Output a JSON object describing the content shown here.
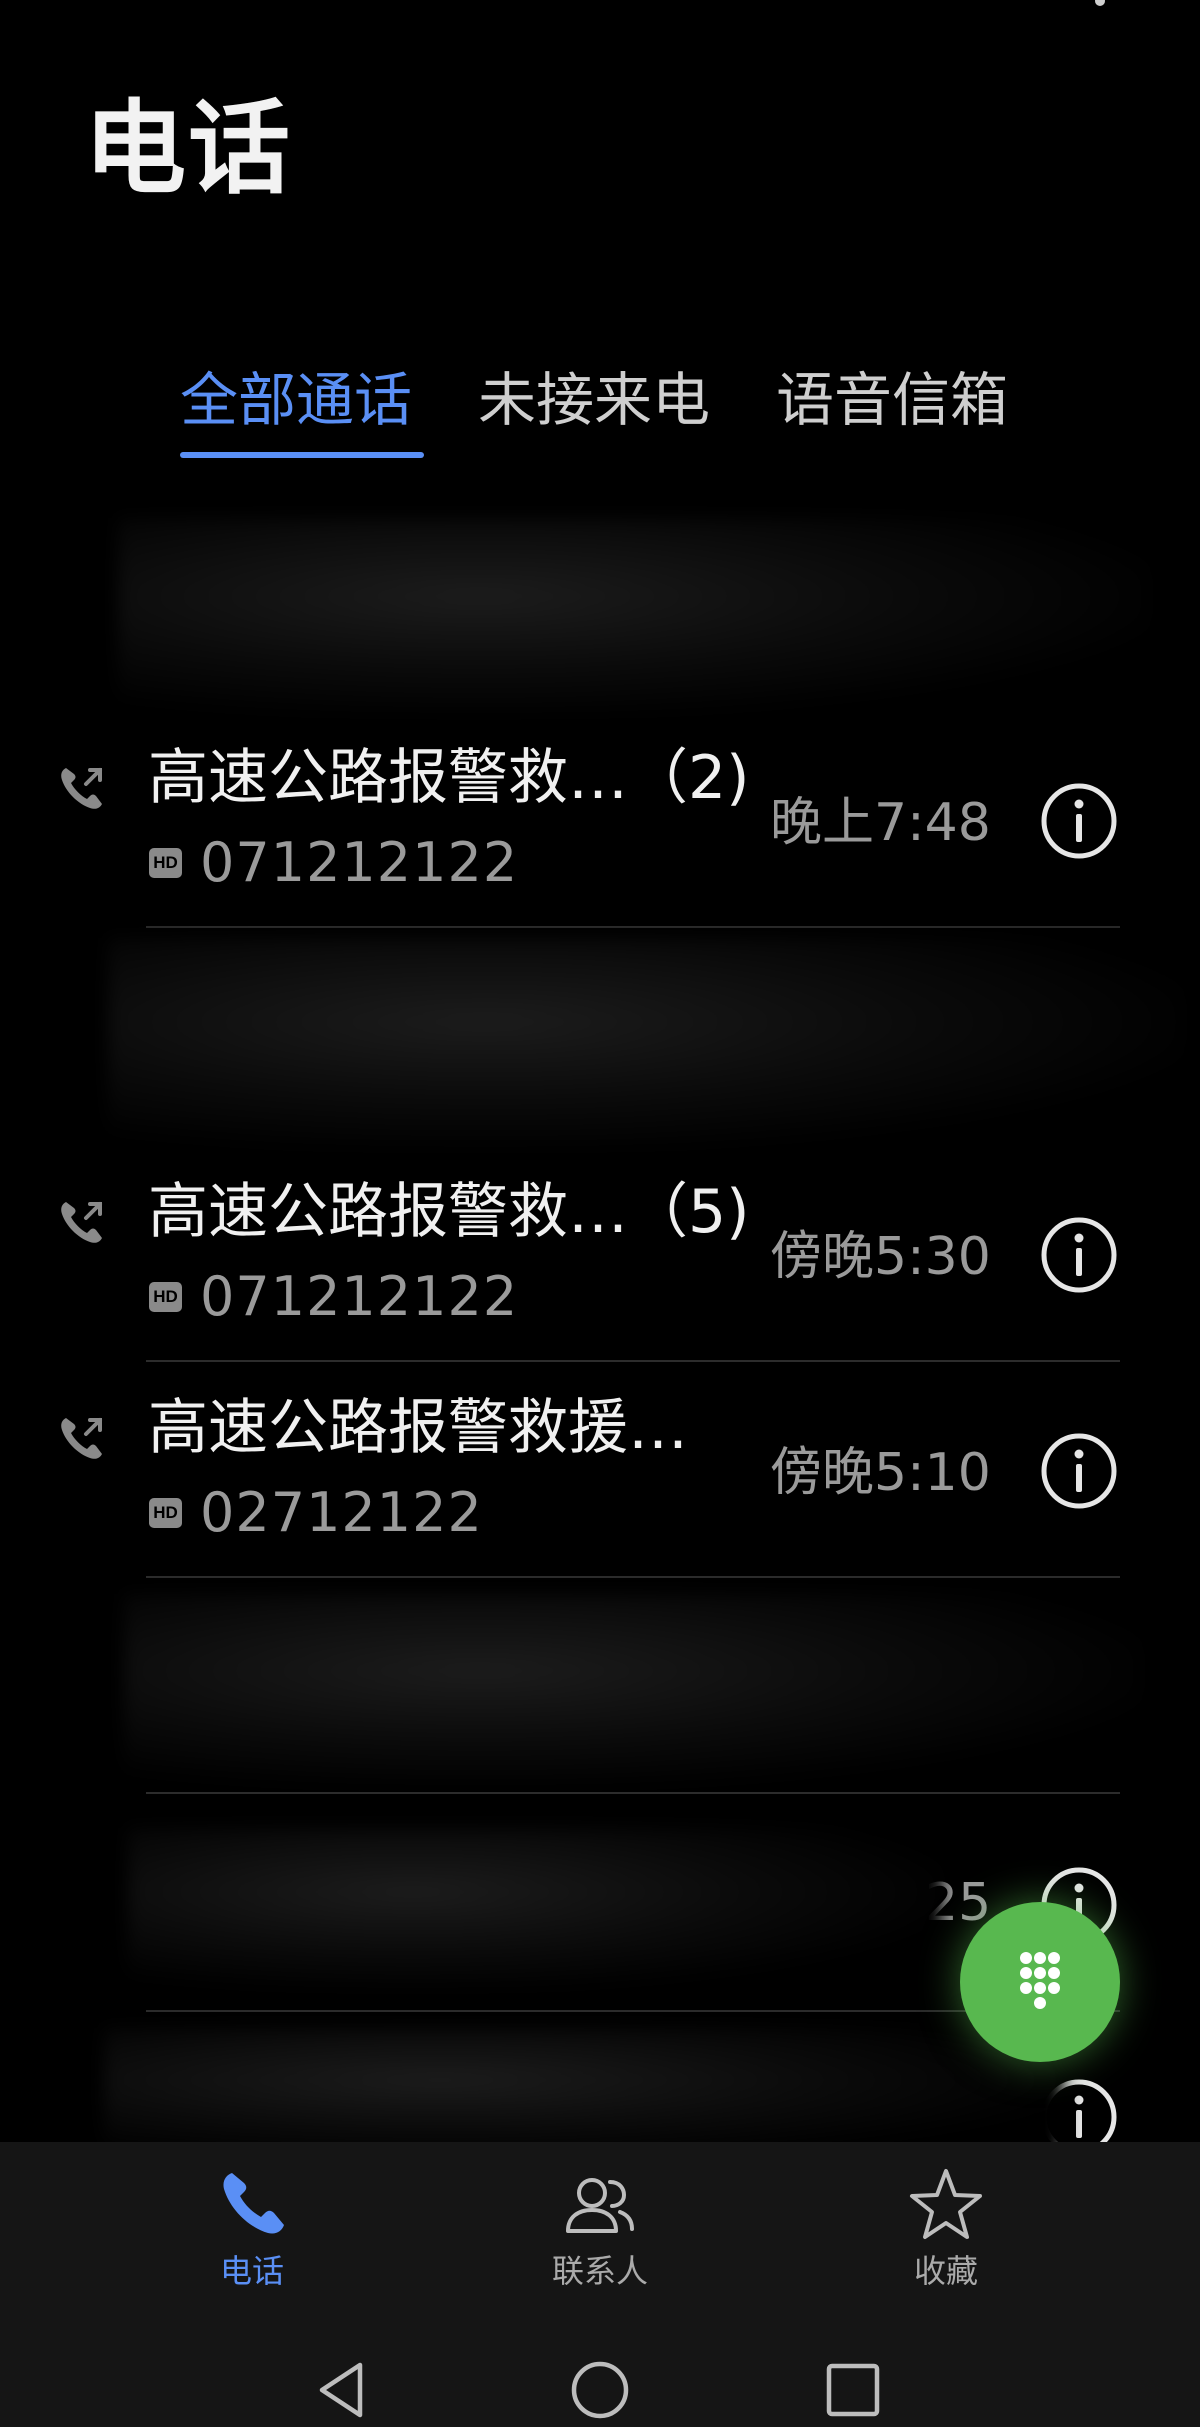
{
  "header": {
    "title": "电话"
  },
  "tabs": [
    {
      "label": "全部通话",
      "active": true
    },
    {
      "label": "未接来电",
      "active": false
    },
    {
      "label": "语音信箱",
      "active": false
    }
  ],
  "calls": [
    {
      "name": "高速公路报警救…（2)",
      "badge": "HD",
      "number": "071212122",
      "time": "晚上7:48",
      "icon": "outgoing-call-icon"
    },
    {
      "name": "高速公路报警救…（5)",
      "badge": "HD",
      "number": "071212122",
      "time": "傍晚5:30",
      "icon": "outgoing-call-icon"
    },
    {
      "name": "高速公路报警救援…",
      "badge": "HD",
      "number": "02712122",
      "time": "傍晚5:10",
      "icon": "outgoing-call-icon"
    }
  ],
  "partial_row": {
    "time_fragment": "25"
  },
  "bottom_nav": [
    {
      "label": "电话",
      "icon": "phone-icon",
      "active": true
    },
    {
      "label": "联系人",
      "icon": "contacts-icon",
      "active": false
    },
    {
      "label": "收藏",
      "icon": "star-icon",
      "active": false
    }
  ],
  "colors": {
    "accent": "#5a8ff5",
    "fab": "#58b84f",
    "background": "#000000"
  }
}
